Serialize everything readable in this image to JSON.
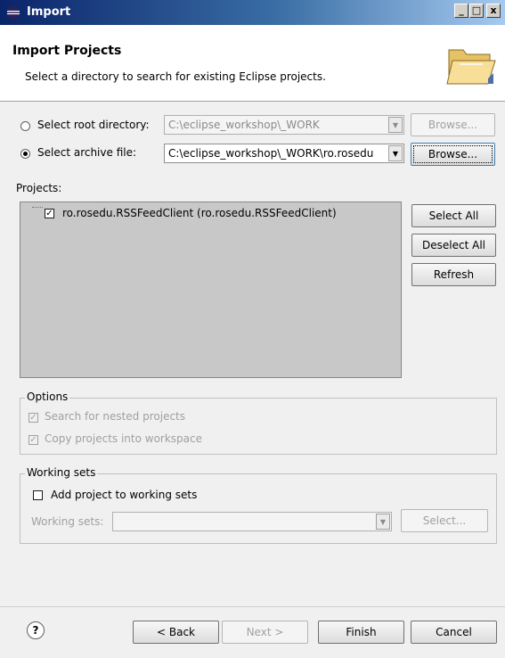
{
  "window": {
    "title": "Import",
    "minimize": "_",
    "maximize": "□",
    "close": "x"
  },
  "header": {
    "title": "Import Projects",
    "description": "Select a directory to search for existing Eclipse projects."
  },
  "source": {
    "root_label": "Select root directory:",
    "root_value": "C:\\eclipse_workshop\\_WORK",
    "root_browse": "Browse...",
    "archive_label": "Select archive file:",
    "archive_value": "C:\\eclipse_workshop\\_WORK\\ro.rosedu",
    "archive_browse": "Browse...",
    "selected": "archive"
  },
  "projects": {
    "label": "Projects:",
    "items": [
      {
        "label": "ro.rosedu.RSSFeedClient (ro.rosedu.RSSFeedClient)",
        "checked": true
      }
    ],
    "select_all": "Select All",
    "deselect_all": "Deselect All",
    "refresh": "Refresh"
  },
  "options": {
    "legend": "Options",
    "nested": "Search for nested projects",
    "copy": "Copy projects into workspace"
  },
  "working_sets": {
    "legend": "Working sets",
    "add_label": "Add project to working sets",
    "sets_label": "Working sets:",
    "select_button": "Select..."
  },
  "footer": {
    "help": "?",
    "back": "< Back",
    "next": "Next >",
    "finish": "Finish",
    "cancel": "Cancel"
  }
}
